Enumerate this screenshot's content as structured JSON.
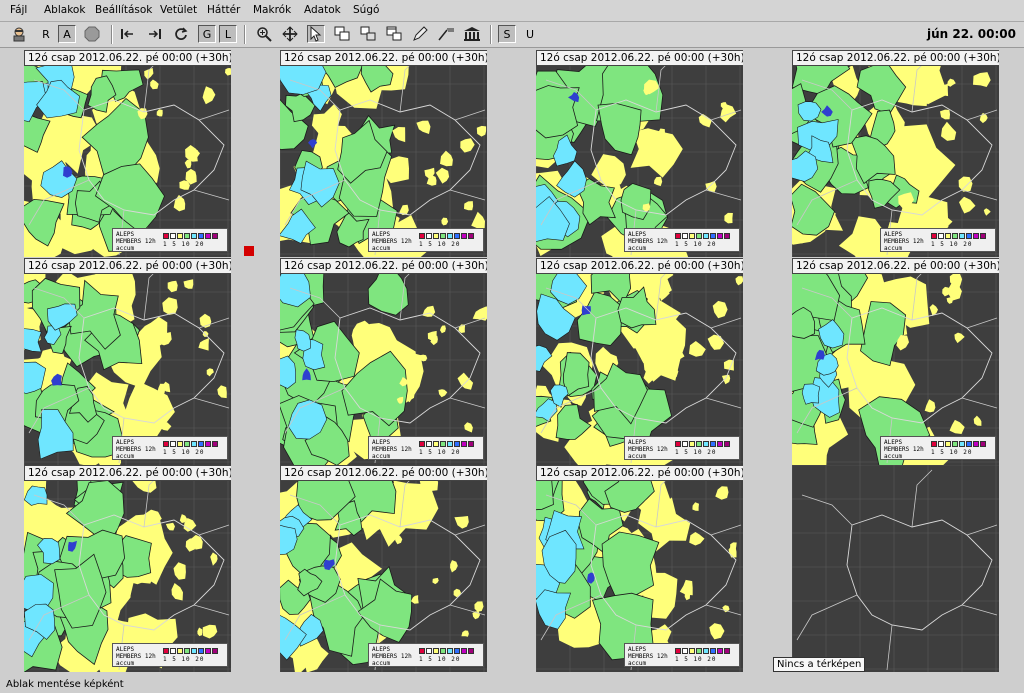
{
  "menubar": {
    "items": [
      "Fájl",
      "Ablakok",
      "Beállítások",
      "Vetület",
      "Háttér",
      "Makrók",
      "Adatok",
      "Súgó"
    ]
  },
  "toolbar": {
    "label_r": "R",
    "label_a": "A",
    "label_g": "G",
    "label_l": "L",
    "label_s": "S",
    "label_u": "U",
    "clock": "jún 22. 00:00"
  },
  "panels": [
    {
      "title": "12ó csap 2012.06.22. pé 00:00 (+30h)",
      "has_data": true
    },
    {
      "title": "12ó csap 2012.06.22. pé 00:00 (+30h)",
      "has_data": true
    },
    {
      "title": "12ó csap 2012.06.22. pé 00:00 (+30h)",
      "has_data": true
    },
    {
      "title": "12ó csap 2012.06.22. pé 00:00 (+30h)",
      "has_data": true
    },
    {
      "title": "12ó csap 2012.06.22. pé 00:00 (+30h)",
      "has_data": true
    },
    {
      "title": "12ó csap 2012.06.22. pé 00:00 (+30h)",
      "has_data": true
    },
    {
      "title": "12ó csap 2012.06.22. pé 00:00 (+30h)",
      "has_data": true
    },
    {
      "title": "12ó csap 2012.06.22. pé 00:00 (+30h)",
      "has_data": true
    },
    {
      "title": "12ó csap 2012.06.22. pé 00:00 (+30h)",
      "has_data": true
    },
    {
      "title": "12ó csap 2012.06.22. pé 00:00 (+30h)",
      "has_data": true
    },
    {
      "title": "12ó csap 2012.06.22. pé 00:00 (+30h)",
      "has_data": true
    },
    {
      "title": "",
      "has_data": false
    }
  ],
  "legend": {
    "text": "ALEPS MEMBERS 12h accum",
    "scale": "1  5  10  20",
    "colors": [
      "#e0003c",
      "#ffffff",
      "#ffff7a",
      "#7fe57f",
      "#6fe6ff",
      "#2f6fff",
      "#c000c0",
      "#a0007a"
    ]
  },
  "colors": {
    "ocean": "#3e3e3e",
    "light_precip": "#ffff7a",
    "medium_precip": "#7fe57f",
    "heavy_precip": "#6fe6ff",
    "extreme_precip": "#2f3fcf"
  },
  "tooltip": "Nincs a térképen",
  "status": "Ablak mentése képként"
}
